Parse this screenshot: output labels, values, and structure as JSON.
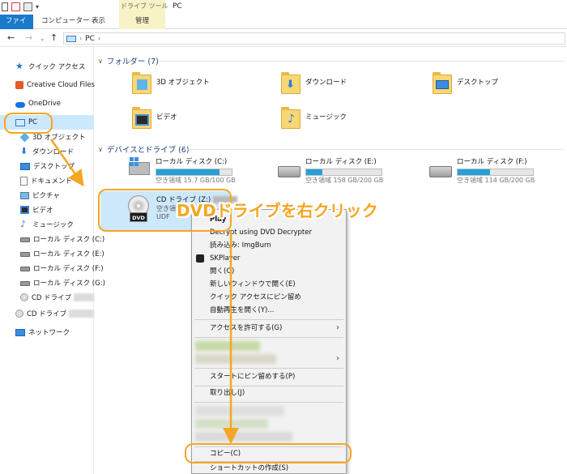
{
  "ribbon": {
    "context_tab_group": "ドライブ ツール",
    "window_title": "PC",
    "tabs": {
      "file": "ファイル",
      "computer": "コンピューター",
      "view": "表示",
      "manage": "管理"
    }
  },
  "address": {
    "back_glyph": "←",
    "forward_glyph": "→",
    "history_glyph": "⌄",
    "up_glyph": "↑",
    "separator": "›",
    "path": "PC",
    "separator_end": "›"
  },
  "sidebar": {
    "items": [
      {
        "label": "クイック アクセス",
        "icon": "star-icon"
      },
      {
        "label": "Creative Cloud Files",
        "icon": "creative-cloud-icon"
      },
      {
        "label": "OneDrive",
        "icon": "cloud-icon"
      },
      {
        "label": "PC",
        "icon": "pc-icon",
        "selected": true
      },
      {
        "label": "3D オブジェクト",
        "icon": "3d-objects-icon"
      },
      {
        "label": "ダウンロード",
        "icon": "download-icon"
      },
      {
        "label": "デスクトップ",
        "icon": "desktop-icon"
      },
      {
        "label": "ドキュメント",
        "icon": "document-icon"
      },
      {
        "label": "ピクチャ",
        "icon": "picture-icon"
      },
      {
        "label": "ビデオ",
        "icon": "video-icon"
      },
      {
        "label": "ミュージック",
        "icon": "music-icon"
      },
      {
        "label": "ローカル ディスク (C:)",
        "icon": "drive-icon"
      },
      {
        "label": "ローカル ディスク (E:)",
        "icon": "drive-icon"
      },
      {
        "label": "ローカル ディスク (F:)",
        "icon": "drive-icon"
      },
      {
        "label": "ローカル ディスク (G:)",
        "icon": "drive-icon"
      },
      {
        "label": "CD ドライブ",
        "icon": "disc-icon"
      },
      {
        "label": "CD ドライブ",
        "icon": "disc-icon"
      },
      {
        "label": "ネットワーク",
        "icon": "network-icon"
      }
    ]
  },
  "folders": {
    "header": "フォルダー (7)",
    "items": [
      {
        "label": "3D オブジェクト",
        "icon": "3d-objects-folder-icon"
      },
      {
        "label": "ダウンロード",
        "icon": "downloads-folder-icon"
      },
      {
        "label": "デスクトップ",
        "icon": "desktop-folder-icon"
      },
      {
        "label": "ビデオ",
        "icon": "videos-folder-icon"
      },
      {
        "label": "ミュージック",
        "icon": "music-folder-icon"
      }
    ]
  },
  "drives": {
    "header": "デバイスとドライブ (6)",
    "items": [
      {
        "name": "ローカル ディスク (C:)",
        "free": "空き領域 15.7 GB/100 GB",
        "used_fraction": 0.843,
        "icon": "windows-drive-icon"
      },
      {
        "name": "ローカル ディスク (E:)",
        "free": "空き領域 158 GB/200 GB",
        "used_fraction": 0.21,
        "icon": "hard-drive-icon"
      },
      {
        "name": "ローカル ディスク (F:)",
        "free": "空き領域 114 GB/200 GB",
        "used_fraction": 0.43,
        "icon": "hard-drive-icon"
      }
    ],
    "cd": {
      "name": "CD ドライブ (Z:)",
      "free": "空き領域",
      "fs": "UDF",
      "badge": "DVD"
    }
  },
  "annotation": {
    "text": "DVDドライブを右クリック",
    "color": "#f5a623"
  },
  "context_menu": {
    "items": [
      {
        "label": "Play"
      },
      {
        "label": "Decrypt using DVD Decrypter"
      },
      {
        "label": "読み込み: ImgBurn"
      },
      {
        "label": "SKPlayer"
      },
      {
        "label": "開く(O)"
      },
      {
        "label": "新しいウィンドウで開く(E)"
      },
      {
        "label": "クイック アクセスにピン留め"
      },
      {
        "label": "自動再生を開く(Y)..."
      },
      {
        "label": "アクセスを許可する(G)"
      },
      {
        "label": "スタートにピン留めする(P)"
      },
      {
        "label": "取り出し(J)"
      },
      {
        "label": "コピー(C)"
      },
      {
        "label": "ショートカットの作成(S)"
      }
    ],
    "submenu_glyph": "›"
  },
  "colors": {
    "accent": "#1979ca",
    "selection": "#cce8ff",
    "annotation": "#f5a623"
  }
}
